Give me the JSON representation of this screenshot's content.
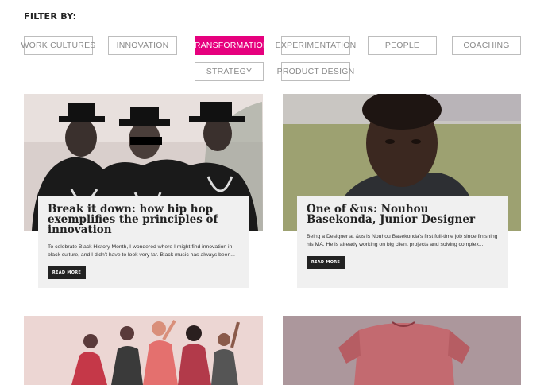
{
  "filter": {
    "title": "FILTER BY:",
    "options": [
      {
        "label": "WORK CULTURES"
      },
      {
        "label": "INNOVATION"
      },
      {
        "label": "TRANSFORMATION"
      },
      {
        "label": "EXPERIMENTATION"
      },
      {
        "label": "PEOPLE"
      },
      {
        "label": "COACHING"
      },
      {
        "label": "STRATEGY"
      },
      {
        "label": "PRODUCT DESIGN"
      }
    ],
    "active": "TRANSFORMATION",
    "accent_color": "#e6007e"
  },
  "articles": [
    {
      "title": "Break it down: how hip hop exemplifies the principles of innovation",
      "excerpt": "To celebrate Black History Month, I wondered where I might find innovation in black culture, and I didn't have to look very far. Black music has always been...",
      "button": "READ MORE",
      "image": "group-portrait-photo"
    },
    {
      "title": "One of &us: Nouhou Basekonda, Junior Designer",
      "excerpt": "Being a Designer at &us is Nouhou Basekonda's first full-time job since finishing his MA. He is already working on big client projects and solving complex...",
      "button": "READ MORE",
      "image": "portrait-photo"
    },
    {
      "image": "team-illustration"
    },
    {
      "image": "pink-shirt-photo"
    }
  ]
}
